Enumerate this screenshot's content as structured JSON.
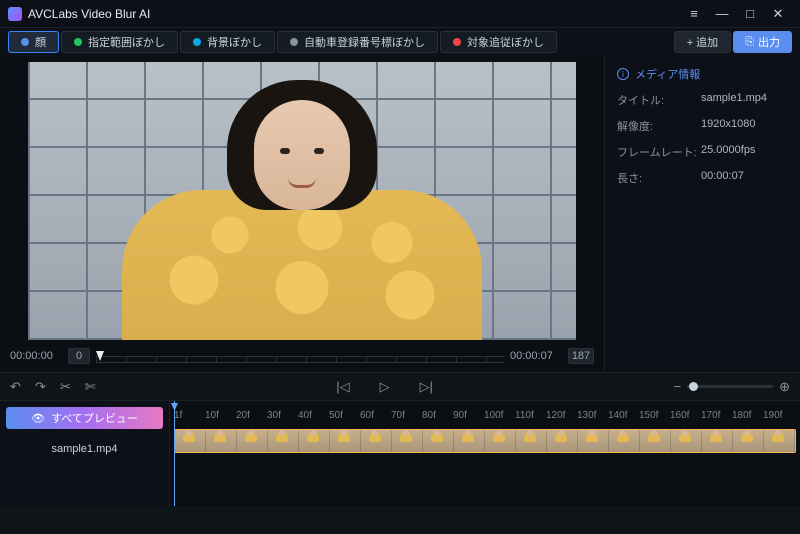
{
  "app_title": "AVCLabs Video Blur AI",
  "window": {
    "menu": "≡",
    "min": "—",
    "max": "□",
    "close": "✕"
  },
  "modes": [
    {
      "label": "顔",
      "color": "#5b8def",
      "active": true
    },
    {
      "label": "指定範囲ぼかし",
      "color": "#22c55e",
      "active": false
    },
    {
      "label": "背景ぼかし",
      "color": "#0ea5e9",
      "active": false
    },
    {
      "label": "自動車登録番号標ぼかし",
      "color": "#8a929c",
      "active": false
    },
    {
      "label": "対象追従ぼかし",
      "color": "#ef4444",
      "active": false
    }
  ],
  "toolbar": {
    "add": "+ 追加",
    "export": "出力"
  },
  "scrub": {
    "t0": "00:00:00",
    "f0": "0",
    "t1": "00:00:07",
    "f1": "187"
  },
  "media_info": {
    "header": "メディア情報",
    "rows": [
      {
        "k": "タイトル:",
        "v": "sample1.mp4"
      },
      {
        "k": "解像度:",
        "v": "1920x1080"
      },
      {
        "k": "フレームレート:",
        "v": "25.0000fps"
      },
      {
        "k": "長さ:",
        "v": "00:00:07"
      }
    ]
  },
  "editbar": {
    "undo": "↶",
    "redo": "↷",
    "cut": "✂",
    "split": "✄",
    "prev": "|◁",
    "play": "▷",
    "next": "▷|",
    "zoom_out": "−",
    "zoom_in": "⊕"
  },
  "preview_all": "すべてプレビュー",
  "clip_name": "sample1.mp4",
  "ruler": [
    "1f",
    "10f",
    "20f",
    "30f",
    "40f",
    "50f",
    "60f",
    "70f",
    "80f",
    "90f",
    "100f",
    "110f",
    "120f",
    "130f",
    "140f",
    "150f",
    "160f",
    "170f",
    "180f",
    "190f"
  ]
}
